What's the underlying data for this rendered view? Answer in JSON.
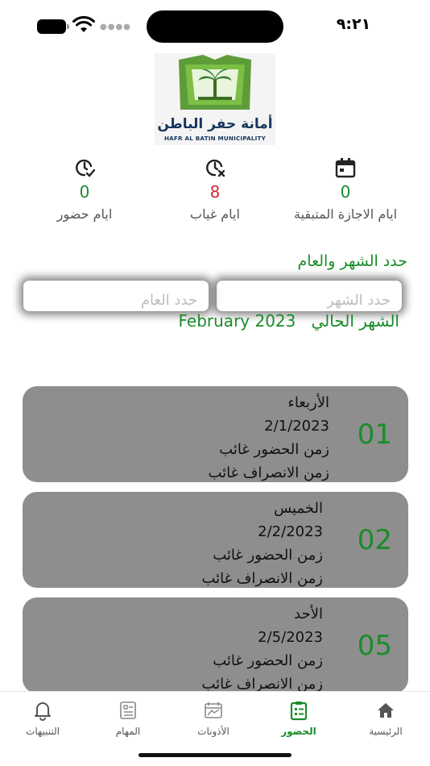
{
  "status_bar": {
    "time": "٩:٢١"
  },
  "logo": {
    "name_ar": "أمانة حفر الباطن",
    "name_en": "HAFR AL BATIN MUNICIPALITY"
  },
  "stats": [
    {
      "value": "0",
      "label": "ايام حضور",
      "icon": "clock-check-icon"
    },
    {
      "value": "8",
      "label": "ايام غياب",
      "icon": "clock-x-icon"
    },
    {
      "value": "0",
      "label": "ايام الاجازة المتبقية",
      "icon": "calendar-icon"
    }
  ],
  "filter": {
    "title": "حدد الشهر والعام",
    "month_placeholder": "حدد الشهر",
    "year_placeholder": "حدد العام",
    "current_label": "الشهر الحالي",
    "current_value": "February 2023"
  },
  "days": [
    {
      "day_number": "01",
      "weekday": "الأربعاء",
      "date": "2/1/2023",
      "check_in": "زمن الحضور  غائب",
      "check_out": "زمن الانصراف  غائب"
    },
    {
      "day_number": "02",
      "weekday": "الخميس",
      "date": "2/2/2023",
      "check_in": "زمن الحضور  غائب",
      "check_out": "زمن الانصراف  غائب"
    },
    {
      "day_number": "05",
      "weekday": "الأحد",
      "date": "2/5/2023",
      "check_in": "زمن الحضور  غائب",
      "check_out": "زمن الانصراف  غائب"
    }
  ],
  "tabs": [
    {
      "label": "التنبيهات",
      "icon": "bell-icon"
    },
    {
      "label": "المهام",
      "icon": "tasks-icon"
    },
    {
      "label": "الأذونات",
      "icon": "permissions-icon"
    },
    {
      "label": "الحضور",
      "icon": "attendance-icon",
      "active": true
    },
    {
      "label": "الرئيسية",
      "icon": "home-icon"
    }
  ],
  "colors": {
    "accent": "#1a8c2a",
    "absence": "#d62839",
    "card": "#8e8e8e"
  }
}
